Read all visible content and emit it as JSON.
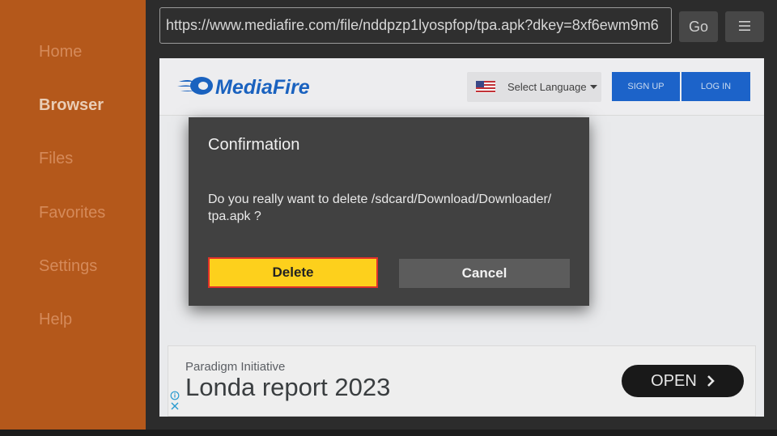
{
  "sidebar": {
    "items": [
      {
        "label": "Home",
        "active": false
      },
      {
        "label": "Browser",
        "active": true
      },
      {
        "label": "Files",
        "active": false
      },
      {
        "label": "Favorites",
        "active": false
      },
      {
        "label": "Settings",
        "active": false
      },
      {
        "label": "Help",
        "active": false
      }
    ]
  },
  "toolbar": {
    "url": "https://www.mediafire.com/file/nddpzp1lyospfop/tpa.apk?dkey=8xf6ewm9m6",
    "go_label": "Go",
    "menu_icon": "hamburger-menu-icon"
  },
  "website": {
    "logo_text": "MediaFire",
    "language_label": "Select Language",
    "signup_label": "SIGN UP",
    "login_label": "LOG IN"
  },
  "ad": {
    "advertiser": "Paradigm Initiative",
    "title": "Londa report 2023",
    "cta": "OPEN"
  },
  "dialog": {
    "title": "Confirmation",
    "message_line1": "Do you really want to delete /sdcard/Download/Downloader/",
    "message_line2": "tpa.apk ?",
    "delete_label": "Delete",
    "cancel_label": "Cancel"
  },
  "colors": {
    "sidebar_bg": "#b4581b",
    "delete_btn": "#fdd01c",
    "focus_border": "#e0312a",
    "brand_blue": "#1b66c6"
  }
}
